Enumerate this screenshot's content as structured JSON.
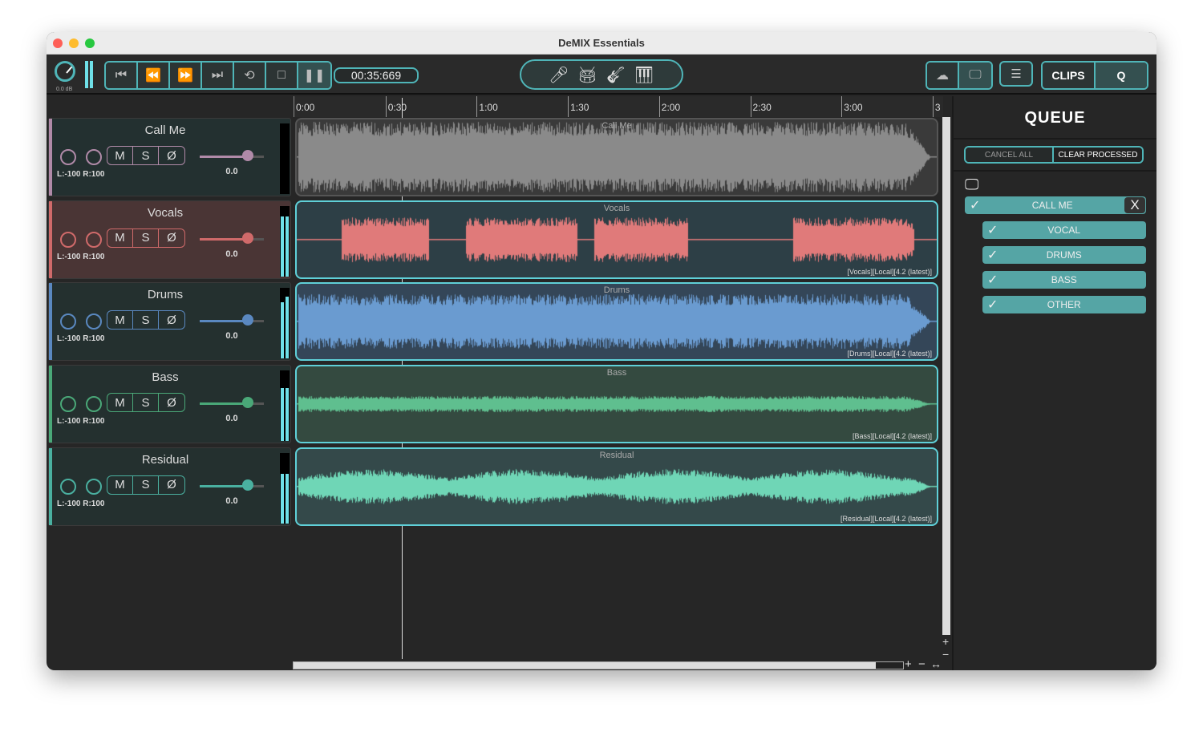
{
  "window": {
    "title": "DeMIX Essentials"
  },
  "toolbar": {
    "master_gain": "0.0 dB",
    "time": "00:35:669",
    "transport": [
      "skip-back",
      "rewind",
      "fast-forward",
      "skip-forward",
      "loop",
      "stop",
      "pause"
    ],
    "instruments": [
      "microphone",
      "drums",
      "guitar",
      "piano"
    ],
    "clips_label": "CLIPS",
    "queue_tab_label": "Q"
  },
  "timeline": {
    "ticks": [
      "0:00",
      "0:30",
      "1:00",
      "1:30",
      "2:00",
      "2:30",
      "3:00",
      "3"
    ],
    "playhead_seconds": 35.669
  },
  "tracks": [
    {
      "name": "Call Me",
      "pan": "L:-100 R:100",
      "gain": "0.0",
      "mute": "M",
      "solo": "S",
      "phase": "Ø",
      "lane_label": "Call Me",
      "tag": "",
      "color": "#b08aa8",
      "wave": "#8a8a8a",
      "meter": [
        0,
        0
      ]
    },
    {
      "name": "Vocals",
      "pan": "L:-100 R:100",
      "gain": "0.0",
      "mute": "M",
      "solo": "S",
      "phase": "Ø",
      "lane_label": "Vocals",
      "tag": "[Vocals][Local][4.2 (latest)]",
      "color": "#d06a6a",
      "wave": "#e07a7a",
      "meter": [
        0.85,
        0.85
      ]
    },
    {
      "name": "Drums",
      "pan": "L:-100 R:100",
      "gain": "0.0",
      "mute": "M",
      "solo": "S",
      "phase": "Ø",
      "lane_label": "Drums",
      "tag": "[Drums][Local][4.2 (latest)]",
      "color": "#5a88c0",
      "wave": "#6a9bd0",
      "meter": [
        0.8,
        0.88
      ]
    },
    {
      "name": "Bass",
      "pan": "L:-100 R:100",
      "gain": "0.0",
      "mute": "M",
      "solo": "S",
      "phase": "Ø",
      "lane_label": "Bass",
      "tag": "[Bass][Local][4.2 (latest)]",
      "color": "#4aa878",
      "wave": "#5fbf8f",
      "meter": [
        0.75,
        0.75
      ]
    },
    {
      "name": "Residual",
      "pan": "L:-100 R:100",
      "gain": "0.0",
      "mute": "M",
      "solo": "S",
      "phase": "Ø",
      "lane_label": "Residual",
      "tag": "[Residual][Local][4.2 (latest)]",
      "color": "#4ab0a0",
      "wave": "#6fd6b6",
      "meter": [
        0.7,
        0.7
      ]
    }
  ],
  "queue": {
    "title": "QUEUE",
    "cancel_all": "CANCEL ALL",
    "clear_processed": "CLEAR PROCESSED",
    "job": {
      "name": "CALL ME",
      "close": "X",
      "stems": [
        "VOCAL",
        "DRUMS",
        "BASS",
        "OTHER"
      ]
    }
  },
  "zoom": {
    "plus": "+",
    "minus": "−",
    "fit": "↔"
  }
}
